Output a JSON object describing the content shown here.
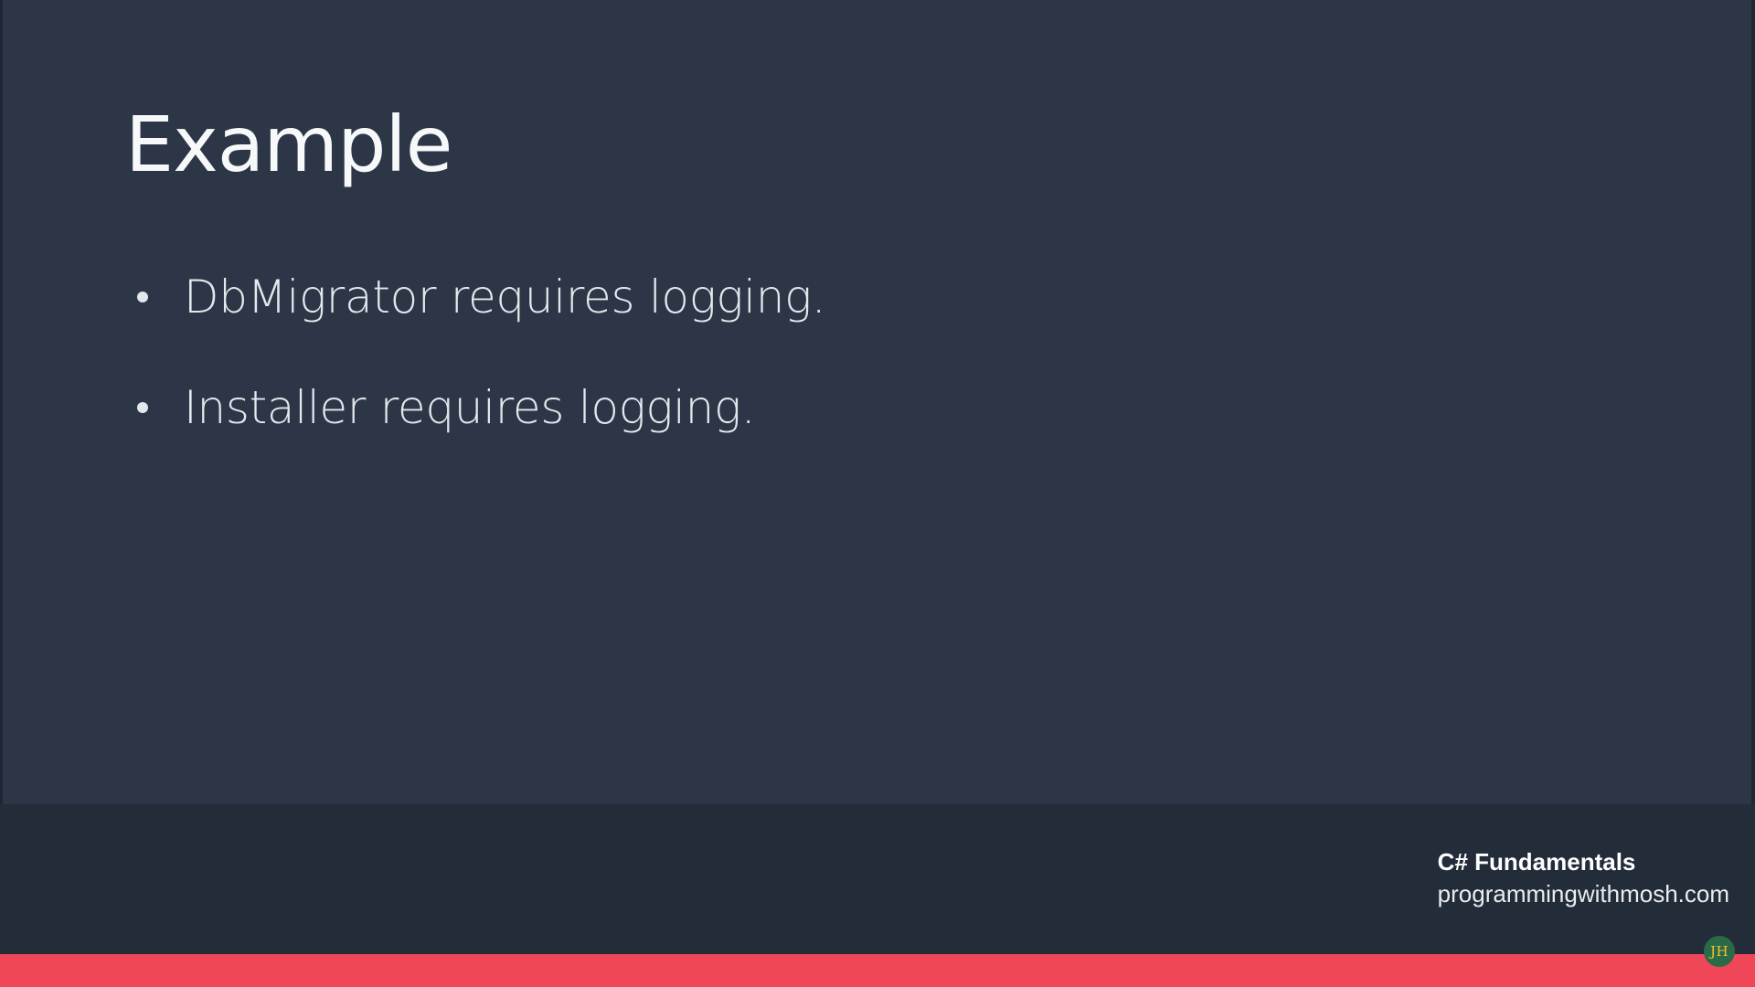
{
  "slide": {
    "title": "Example",
    "bullets": [
      "DbMigrator requires logging.",
      "Installer requires logging."
    ]
  },
  "footer": {
    "course": "C# Fundamentals",
    "site": "programmingwithmosh.com"
  },
  "progress": {
    "fraction": 1.0
  },
  "watermark": {
    "text": "JH"
  },
  "colors": {
    "background": "#2c3646",
    "footer_band": "#232c39",
    "accent": "#ef4658"
  }
}
